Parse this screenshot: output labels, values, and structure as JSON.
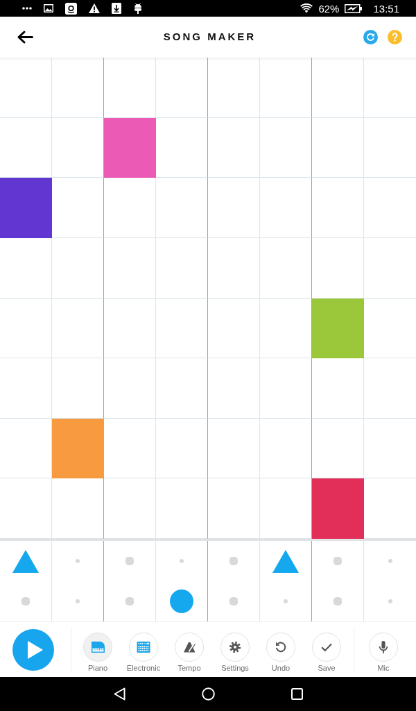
{
  "status_bar": {
    "battery": "62%",
    "time": "13:51"
  },
  "header": {
    "title": "SONG MAKER"
  },
  "melody_grid": {
    "rows": [
      {
        "cells": [
          {
            "on": false
          },
          {
            "on": false
          },
          {
            "on": false
          },
          {
            "on": false
          },
          {
            "on": false
          },
          {
            "on": false
          },
          {
            "on": false
          },
          {
            "on": false
          }
        ]
      },
      {
        "cells": [
          {
            "on": false
          },
          {
            "on": false
          },
          {
            "on": true,
            "color": "#eb5ab5"
          },
          {
            "on": false
          },
          {
            "on": false
          },
          {
            "on": false
          },
          {
            "on": false
          },
          {
            "on": false
          }
        ]
      },
      {
        "cells": [
          {
            "on": true,
            "color": "#6237d1"
          },
          {
            "on": false
          },
          {
            "on": false
          },
          {
            "on": false
          },
          {
            "on": false
          },
          {
            "on": false
          },
          {
            "on": false
          },
          {
            "on": false
          }
        ]
      },
      {
        "cells": [
          {
            "on": false
          },
          {
            "on": false
          },
          {
            "on": false
          },
          {
            "on": false
          },
          {
            "on": false
          },
          {
            "on": false
          },
          {
            "on": false
          },
          {
            "on": false
          }
        ]
      },
      {
        "cells": [
          {
            "on": false
          },
          {
            "on": false
          },
          {
            "on": false
          },
          {
            "on": false
          },
          {
            "on": false
          },
          {
            "on": false
          },
          {
            "on": true,
            "color": "#9bc83a"
          },
          {
            "on": false
          }
        ]
      },
      {
        "cells": [
          {
            "on": false
          },
          {
            "on": false
          },
          {
            "on": false
          },
          {
            "on": false
          },
          {
            "on": false
          },
          {
            "on": false
          },
          {
            "on": false
          },
          {
            "on": false
          }
        ]
      },
      {
        "cells": [
          {
            "on": false
          },
          {
            "on": true,
            "color": "#f89a3f"
          },
          {
            "on": false
          },
          {
            "on": false
          },
          {
            "on": false
          },
          {
            "on": false
          },
          {
            "on": false
          },
          {
            "on": false
          }
        ]
      },
      {
        "cells": [
          {
            "on": false
          },
          {
            "on": false
          },
          {
            "on": false
          },
          {
            "on": false
          },
          {
            "on": false
          },
          {
            "on": false
          },
          {
            "on": true,
            "color": "#e12f5a"
          },
          {
            "on": false
          }
        ]
      }
    ]
  },
  "rhythm_grid": {
    "rows": [
      {
        "kind": "triangle",
        "cells": [
          {
            "on": true
          },
          {
            "on": false
          },
          {
            "on": false
          },
          {
            "on": false
          },
          {
            "on": false
          },
          {
            "on": true
          },
          {
            "on": false
          },
          {
            "on": false
          }
        ]
      },
      {
        "kind": "circle",
        "cells": [
          {
            "on": false
          },
          {
            "on": false
          },
          {
            "on": false
          },
          {
            "on": true
          },
          {
            "on": false
          },
          {
            "on": false
          },
          {
            "on": false
          },
          {
            "on": false
          }
        ]
      }
    ]
  },
  "tools": [
    {
      "kind": "piano",
      "label": "Piano",
      "selected": true
    },
    {
      "kind": "electronic",
      "label": "Electronic",
      "selected": false
    },
    {
      "kind": "tempo",
      "label": "Tempo",
      "selected": false
    },
    {
      "kind": "settings",
      "label": "Settings",
      "selected": false
    },
    {
      "kind": "undo",
      "label": "Undo",
      "selected": false
    },
    {
      "kind": "save",
      "label": "Save",
      "selected": false
    }
  ],
  "mic": {
    "kind": "mic",
    "label": "Mic"
  }
}
